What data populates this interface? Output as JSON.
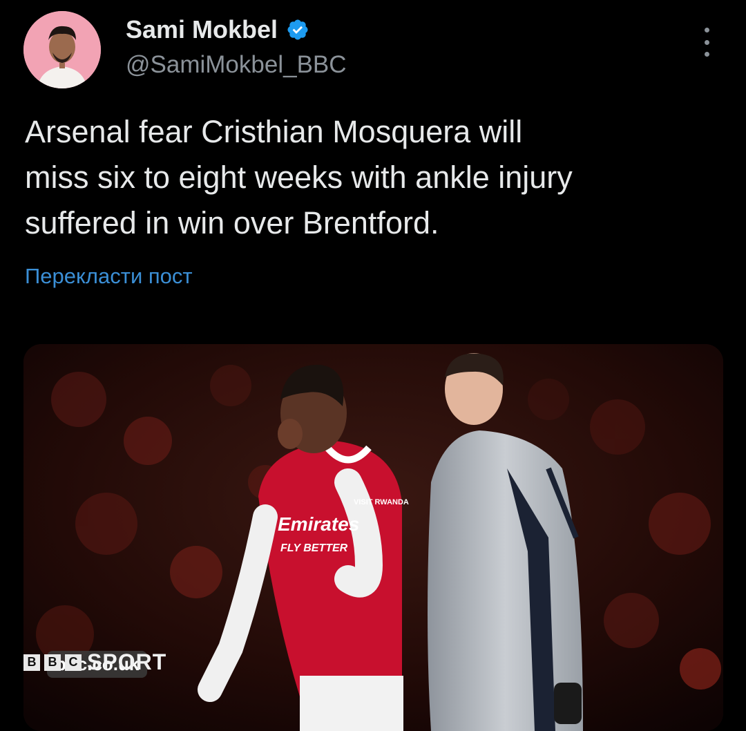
{
  "author": {
    "name": "Sami Mokbel",
    "handle": "@SamiMokbel_BBC",
    "verified": true
  },
  "tweet": {
    "text": "Arsenal fear Cristhian Mosquera will\nmiss six to eight weeks with ankle injury\nsuffered in win over Brentford.",
    "translate_label": "Перекласти пост"
  },
  "media": {
    "url_chip": "bbc.co.uk",
    "logo_letters": [
      "B",
      "B",
      "C"
    ],
    "logo_word": "SPORT",
    "kit_sponsor": "Emirates",
    "kit_tagline": "FLY BETTER",
    "sleeve_text": "VISIT RWANDA"
  },
  "colors": {
    "background": "#000000",
    "text": "#e7e9ea",
    "muted": "#8b9299",
    "link": "#3b8fd6",
    "verified": "#1d9bf0"
  },
  "icons": {
    "verified": "verified-badge-icon",
    "more": "more-options-icon"
  }
}
